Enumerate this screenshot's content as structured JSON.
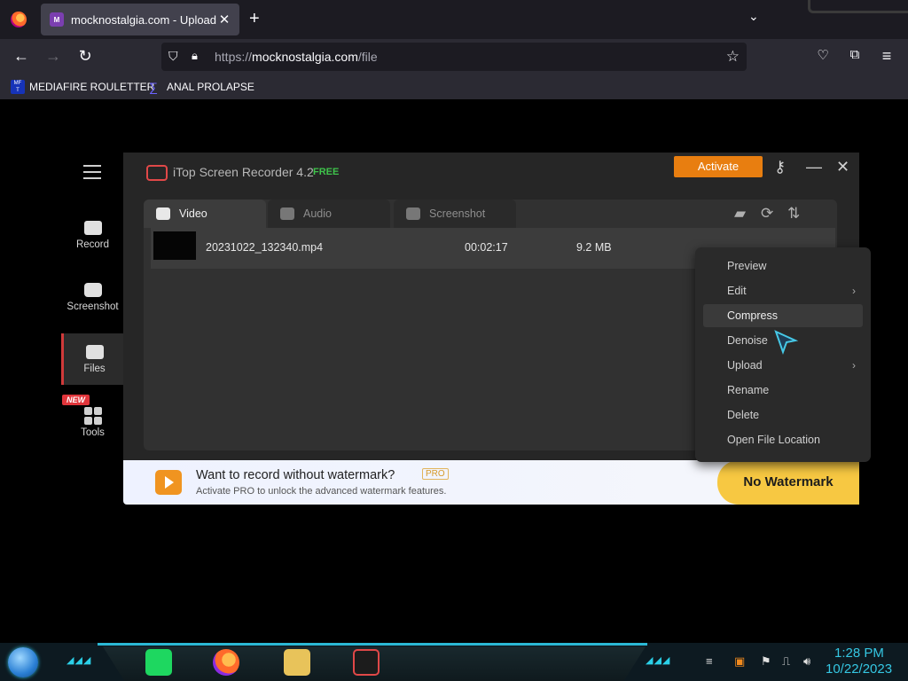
{
  "browser": {
    "tab_title": "mocknostalgia.com - Upload",
    "tab_close": "✕",
    "new_tab": "+",
    "tab_list": "⌄",
    "url_prefix": "https://",
    "url_domain": "mocknostalgia.com",
    "url_path": "/file",
    "bookmarks": [
      {
        "label": "MEDIAFIRE ROULETTER",
        "icon": "mediafire-icon"
      },
      {
        "label": "ANAL PROLAPSE",
        "icon": "bookmark-icon"
      }
    ]
  },
  "app": {
    "title": "iTop Screen Recorder 4.2",
    "free_badge": "FREE",
    "activate_label": "Activate",
    "sidebar": [
      {
        "label": "Record",
        "icon": "video-camera-icon"
      },
      {
        "label": "Screenshot",
        "icon": "camera-icon"
      },
      {
        "label": "Files",
        "icon": "folder-icon"
      },
      {
        "label": "Tools",
        "icon": "tools-grid-icon"
      }
    ],
    "new_badge": "NEW",
    "tabs": [
      {
        "label": "Video",
        "icon": "clapperboard-icon"
      },
      {
        "label": "Audio",
        "icon": "music-note-icon"
      },
      {
        "label": "Screenshot",
        "icon": "image-icon"
      }
    ],
    "files": [
      {
        "name": "20231022_132340.mp4",
        "duration": "00:02:17",
        "size": "9.2 MB"
      }
    ],
    "context_menu": [
      {
        "label": "Preview",
        "submenu": false
      },
      {
        "label": "Edit",
        "submenu": true
      },
      {
        "label": "Compress",
        "submenu": false
      },
      {
        "label": "Denoise",
        "submenu": false
      },
      {
        "label": "Upload",
        "submenu": true
      },
      {
        "label": "Rename",
        "submenu": false
      },
      {
        "label": "Delete",
        "submenu": false
      },
      {
        "label": "Open File Location",
        "submenu": false
      }
    ],
    "banner": {
      "title": "Want to record without watermark?",
      "pro": "PRO",
      "subtitle": "Activate PRO to unlock the advanced watermark features.",
      "button": "No Watermark"
    }
  },
  "taskbar": {
    "time": "1:28 PM",
    "date": "10/22/2023"
  },
  "colors": {
    "accent_orange": "#e87e10",
    "free_green": "#3fc34b",
    "clock_cyan": "#35c7e3",
    "banner_button": "#f7c842"
  }
}
